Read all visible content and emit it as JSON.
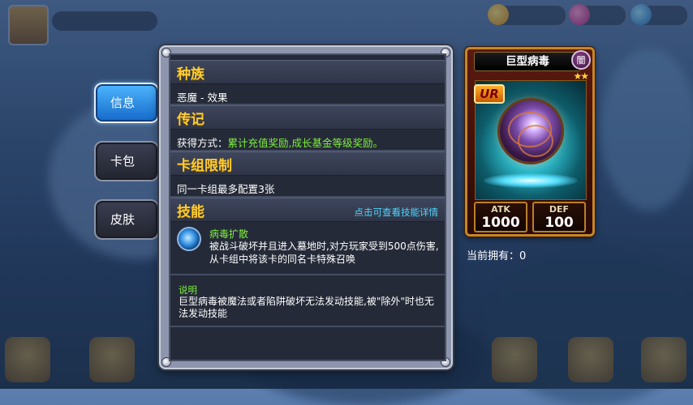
{
  "tabs": [
    {
      "label": "信息",
      "active": true
    },
    {
      "label": "卡包",
      "active": false
    },
    {
      "label": "皮肤",
      "active": false
    }
  ],
  "info": {
    "race": {
      "title": "种族",
      "text": "恶魔 - 效果"
    },
    "bio": {
      "title": "传记",
      "prefix": "获得方式：",
      "text": "累计充值奖励,成长基金等级奖励。"
    },
    "deck_limit": {
      "title": "卡组限制",
      "text": "同一卡组最多配置3张"
    },
    "skill": {
      "title": "技能",
      "detail_link": "点击可查看技能详情",
      "name": "病毒扩散",
      "desc": "被战斗破坏并且进入墓地时,对方玩家受到500点伤害,从卡组中将该卡的同名卡特殊召唤",
      "icon": "virus-skill-icon"
    },
    "note": {
      "title": "说明",
      "text": "巨型病毒被魔法或者陷阱破坏无法发动技能,被\"除外\"时也无法发动技能"
    }
  },
  "card": {
    "name": "巨型病毒",
    "attribute": "闇",
    "rarity": "UR",
    "stars": "★★",
    "atk_label": "ATK",
    "atk": "1000",
    "def_label": "DEF",
    "def": "100"
  },
  "owned_label": "当前拥有：",
  "owned_count": "0",
  "colors": {
    "section_title": "#ffcc33",
    "highlight_green": "#7ef03d",
    "link_cyan": "#4fd6ff",
    "tab_active": "#1f8ae6"
  }
}
